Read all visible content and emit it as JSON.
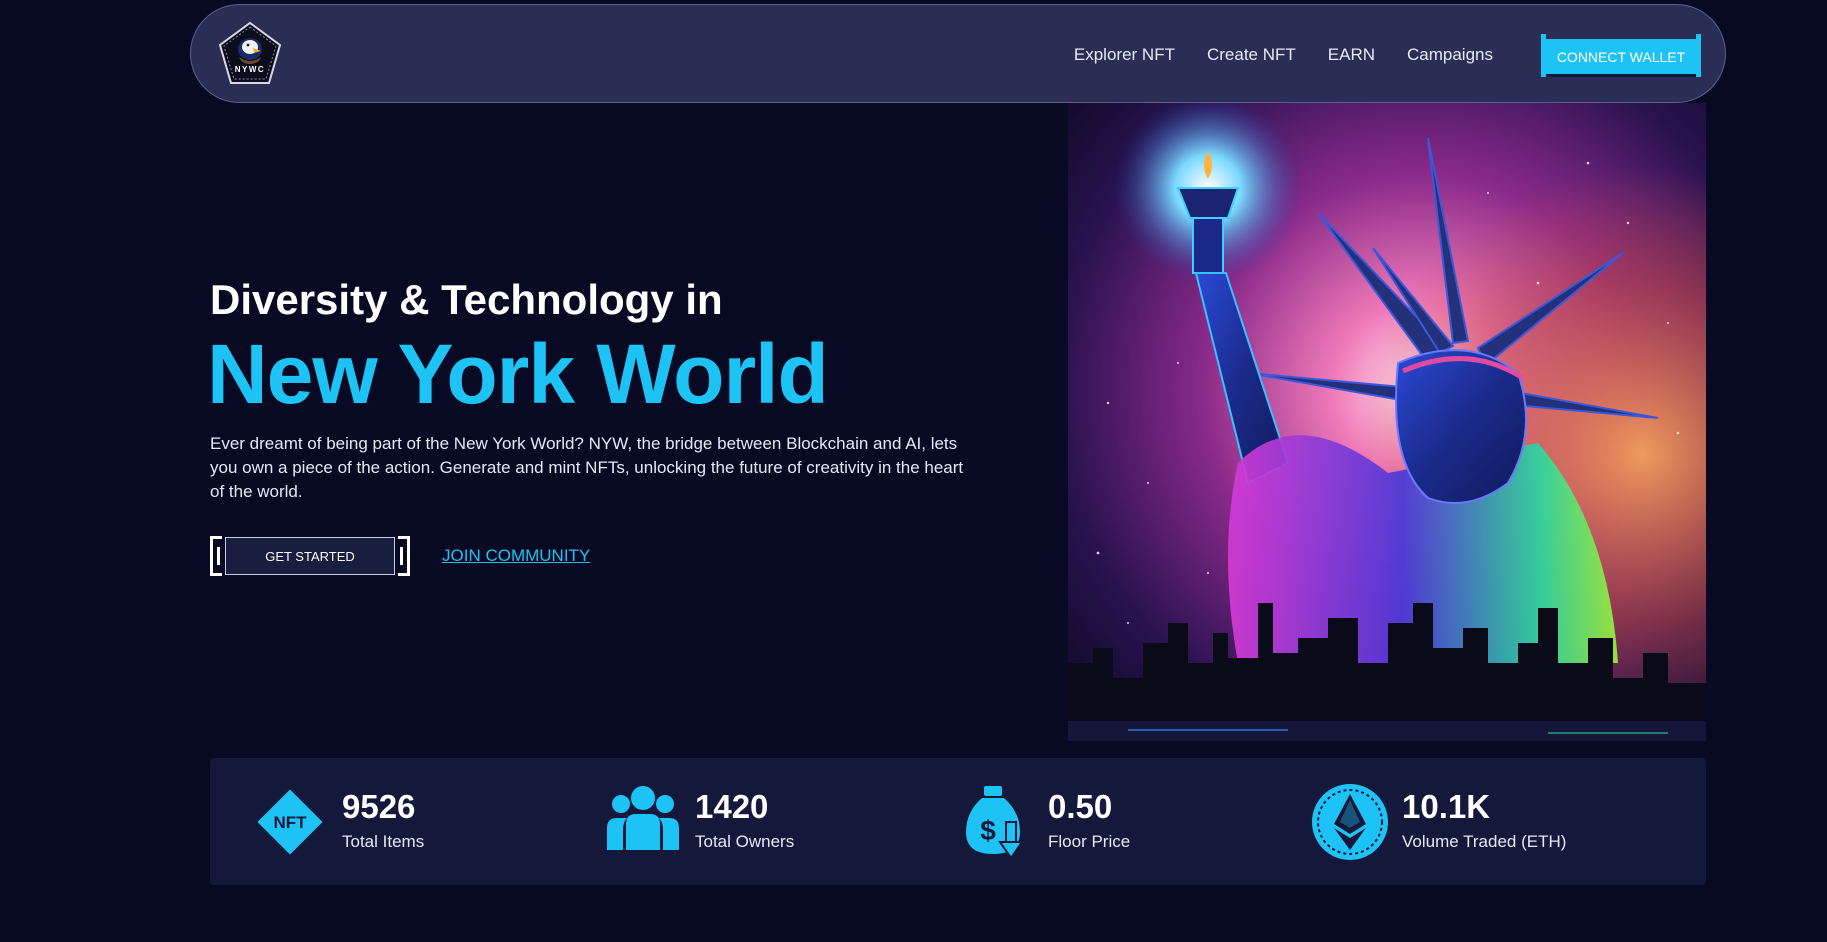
{
  "brand": {
    "logo_text": "NYWC"
  },
  "nav": {
    "links": [
      "Explorer NFT",
      "Create NFT",
      "EARN",
      "Campaigns"
    ],
    "connect_label": "CONNECT WALLET"
  },
  "hero": {
    "subtitle": "Diversity & Technology in",
    "title": "New York World",
    "description": "Ever dreamt of being part of the New York World? NYW, the bridge between Blockchain and AI, lets you own a piece of the action. Generate and mint NFTs, unlocking the future of creativity in the heart of the world.",
    "cta_primary": "GET STARTED",
    "cta_secondary": "JOIN COMMUNITY"
  },
  "stats": [
    {
      "icon": "nft-diamond-icon",
      "icon_text": "NFT",
      "value": "9526",
      "label": "Total Items"
    },
    {
      "icon": "users-icon",
      "value": "1420",
      "label": "Total Owners"
    },
    {
      "icon": "money-bag-icon",
      "value": "0.50",
      "label": "Floor Price"
    },
    {
      "icon": "ethereum-icon",
      "value": "10.1K",
      "label": "Volume Traded (ETH)"
    }
  ],
  "colors": {
    "background": "#070a22",
    "accent": "#1ec3f5",
    "nav_bg": "#2b2e54",
    "stats_bg": "#14183a"
  }
}
